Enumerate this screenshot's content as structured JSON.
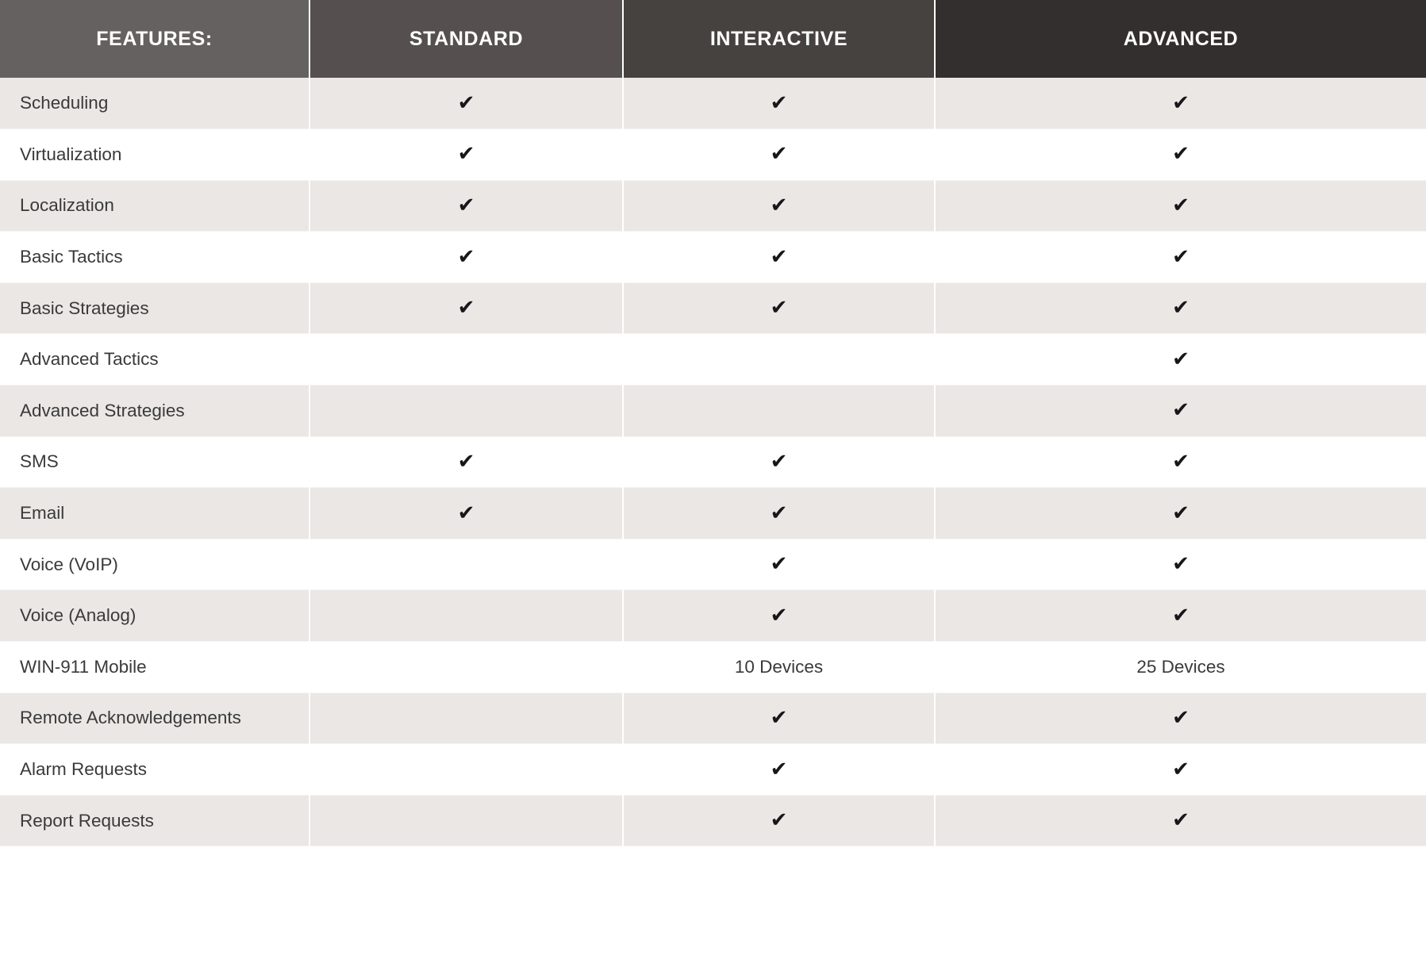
{
  "table": {
    "columns": [
      {
        "key": "feature",
        "label": "FEATURES:",
        "bg": "#656160"
      },
      {
        "key": "standard",
        "label": "STANDARD",
        "bg": "#55504f"
      },
      {
        "key": "interactive",
        "label": "INTERACTIVE",
        "bg": "#46423f"
      },
      {
        "key": "advanced",
        "label": "ADVANCED",
        "bg": "#332f2e"
      }
    ],
    "check_glyph": "✔",
    "colors": {
      "row_odd": "#eae7e4",
      "row_even": "#ffffff",
      "text": "#3a3a3a",
      "check": "#17161a",
      "divider": "#ffffff"
    },
    "rows": [
      {
        "feature": "Scheduling",
        "standard": "✔",
        "interactive": "✔",
        "advanced": "✔"
      },
      {
        "feature": "Virtualization",
        "standard": "✔",
        "interactive": "✔",
        "advanced": "✔"
      },
      {
        "feature": "Localization",
        "standard": "✔",
        "interactive": "✔",
        "advanced": "✔"
      },
      {
        "feature": "Basic Tactics",
        "standard": "✔",
        "interactive": "✔",
        "advanced": "✔"
      },
      {
        "feature": "Basic Strategies",
        "standard": "✔",
        "interactive": "✔",
        "advanced": "✔"
      },
      {
        "feature": "Advanced Tactics",
        "standard": "",
        "interactive": "",
        "advanced": "✔"
      },
      {
        "feature": "Advanced Strategies",
        "standard": "",
        "interactive": "",
        "advanced": "✔"
      },
      {
        "feature": "SMS",
        "standard": "✔",
        "interactive": "✔",
        "advanced": "✔"
      },
      {
        "feature": "Email",
        "standard": "✔",
        "interactive": "✔",
        "advanced": "✔"
      },
      {
        "feature": "Voice (VoIP)",
        "standard": "",
        "interactive": "✔",
        "advanced": "✔"
      },
      {
        "feature": "Voice (Analog)",
        "standard": "",
        "interactive": "✔",
        "advanced": "✔"
      },
      {
        "feature": "WIN-911 Mobile",
        "standard": "",
        "interactive": "10 Devices",
        "advanced": "25 Devices"
      },
      {
        "feature": "Remote Acknowledgements",
        "standard": "",
        "interactive": "✔",
        "advanced": "✔"
      },
      {
        "feature": "Alarm Requests",
        "standard": "",
        "interactive": "✔",
        "advanced": "✔"
      },
      {
        "feature": "Report Requests",
        "standard": "",
        "interactive": "✔",
        "advanced": "✔"
      }
    ]
  }
}
